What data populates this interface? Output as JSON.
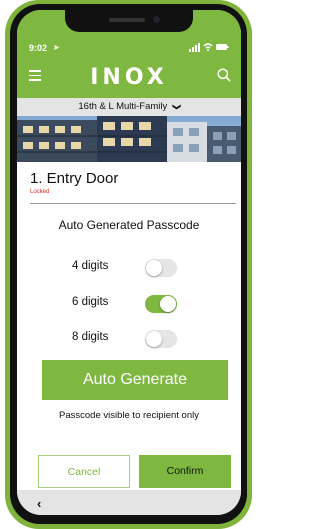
{
  "status_bar": {
    "time": "9:02",
    "icons": "▂▄▆ ≋ ▬"
  },
  "header": {
    "logo": "INOX",
    "menu_icon": "hamburger-icon",
    "search_icon": "search-icon"
  },
  "site": {
    "name": "16th & L Multi-Family",
    "chevron": "❯"
  },
  "door": {
    "title": "1. Entry Door",
    "status": "Locked"
  },
  "passcode": {
    "title": "Auto Generated Passcode",
    "options": [
      {
        "label": "4 digits",
        "enabled": false
      },
      {
        "label": "6 digits",
        "enabled": true
      },
      {
        "label": "8 digits",
        "enabled": false
      }
    ],
    "generate_label": "Auto Generate",
    "note": "Passcode visible to recipient only"
  },
  "actions": {
    "cancel": "Cancel",
    "confirm": "Confirm"
  },
  "nav": {
    "back": "‹"
  },
  "colors": {
    "brand_green": "#7fb840",
    "locked_red": "#d93025"
  }
}
